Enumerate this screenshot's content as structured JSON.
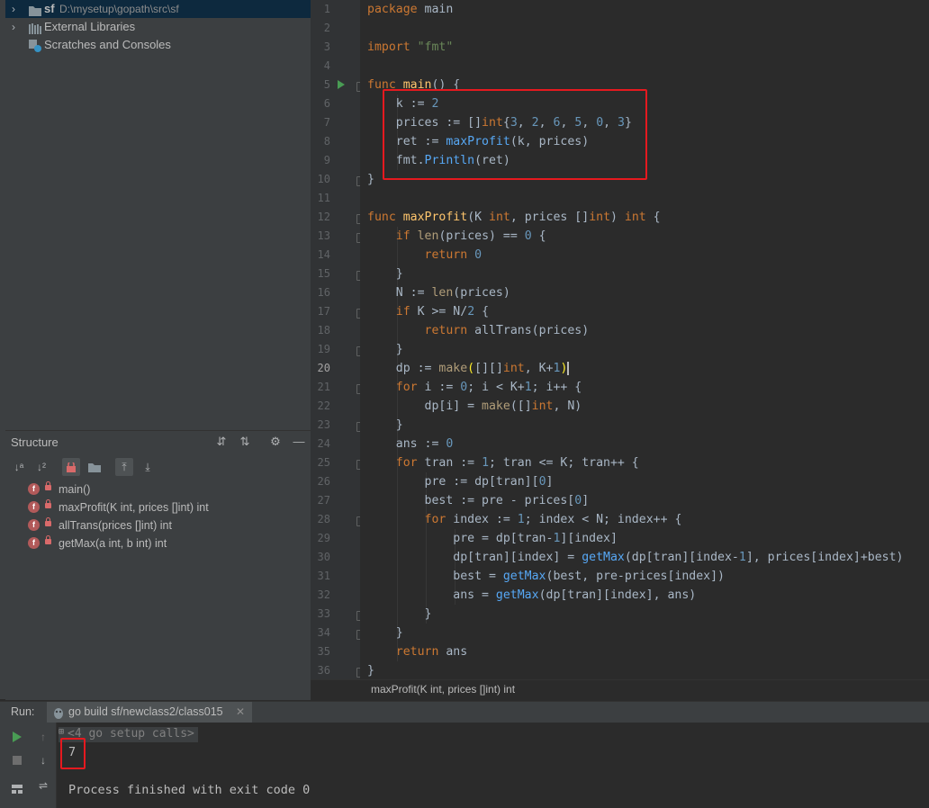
{
  "project": {
    "items": [
      {
        "label": "sf",
        "path": "D:\\mysetup\\gopath\\src\\sf",
        "icon": "folder-icon"
      },
      {
        "label": "External Libraries",
        "icon": "library-icon"
      },
      {
        "label": "Scratches and Consoles",
        "icon": "scratch-icon"
      }
    ]
  },
  "structure": {
    "title": "Structure",
    "items": [
      {
        "badge": "f",
        "label": "main()"
      },
      {
        "badge": "f",
        "label": "maxProfit(K int, prices []int) int"
      },
      {
        "badge": "f",
        "label": "allTrans(prices []int) int"
      },
      {
        "badge": "f",
        "label": "getMax(a int, b int) int"
      }
    ]
  },
  "editor": {
    "line_numbers": [
      "1",
      "2",
      "3",
      "4",
      "5",
      "6",
      "7",
      "8",
      "9",
      "10",
      "11",
      "12",
      "13",
      "14",
      "15",
      "16",
      "17",
      "18",
      "19",
      "20",
      "21",
      "22",
      "23",
      "24",
      "25",
      "26",
      "27",
      "28",
      "29",
      "30",
      "31",
      "32",
      "33",
      "34",
      "35",
      "36"
    ],
    "current_line": "20",
    "breadcrumb": "maxProfit(K int, prices []int) int"
  },
  "run": {
    "label": "Run:",
    "tab": "go build sf/newclass2/class015",
    "folded": "<4 go setup calls>",
    "output": "7",
    "finished": "Process finished with exit code 0"
  },
  "colors": {
    "highlight_box": "#e5191f",
    "keyword": "#cc7832",
    "number": "#6897bb",
    "string": "#6a8759",
    "function": "#ffc66d"
  }
}
